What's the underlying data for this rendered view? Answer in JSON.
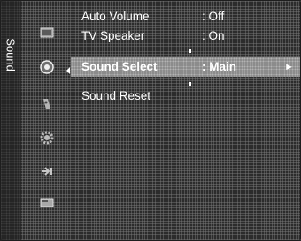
{
  "side_tab": {
    "label": "Sound"
  },
  "icons": [
    "picture-icon",
    "sound-icon",
    "channel-icon",
    "setup-icon",
    "input-icon",
    "application-icon"
  ],
  "menu": {
    "items": [
      {
        "label": "Auto Volume",
        "value": ": Off"
      },
      {
        "label": "TV Speaker",
        "value": ": On"
      },
      {
        "label": "Sound Select",
        "value": ": Main",
        "arrow": "►"
      },
      {
        "label": "Sound Reset",
        "value": ""
      }
    ]
  }
}
